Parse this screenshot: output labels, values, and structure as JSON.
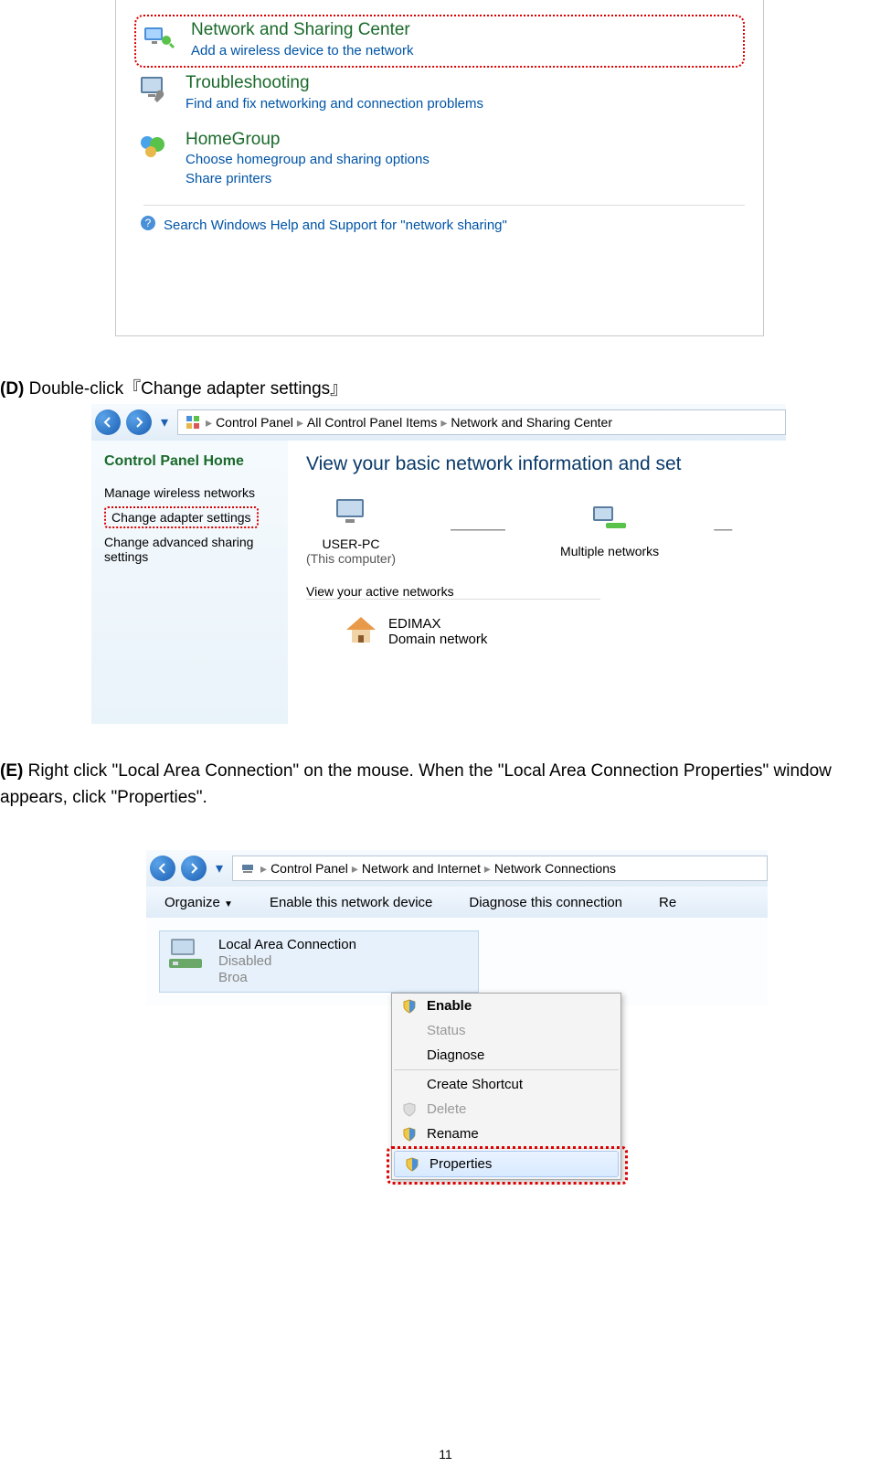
{
  "fig1": {
    "network_sharing": {
      "title": "Network and Sharing Center",
      "sub": "Add a wireless device to the network"
    },
    "troubleshooting": {
      "title": "Troubleshooting",
      "sub": "Find and fix networking and connection problems"
    },
    "homegroup": {
      "title": "HomeGroup",
      "sub1": "Choose homegroup and sharing options",
      "sub2": "Share printers"
    },
    "help_line": "Search Windows Help and Support for \"network sharing\""
  },
  "instruction_d": {
    "label": "(D)",
    "text": "Double-click『Change adapter settings』"
  },
  "fig2": {
    "breadcrumb": {
      "a": "Control Panel",
      "b": "All Control Panel Items",
      "c": "Network and Sharing Center"
    },
    "sidebar": {
      "home": "Control Panel Home",
      "items": [
        "Manage wireless networks",
        "Change adapter settings",
        "Change advanced sharing settings"
      ]
    },
    "main": {
      "heading": "View your basic network information and set",
      "pc_name": "USER-PC",
      "pc_sub": "(This computer)",
      "networks_label": "Multiple networks",
      "active_label": "View your active networks",
      "edimax_name": "EDIMAX",
      "edimax_type": "Domain network"
    }
  },
  "instruction_e": {
    "label": "(E)",
    "text": "Right click \"Local Area Connection\" on the mouse. When the \"Local Area Connection Properties\" window appears, click \"Properties\"."
  },
  "fig3": {
    "breadcrumb": {
      "a": "Control Panel",
      "b": "Network and Internet",
      "c": "Network Connections"
    },
    "toolbar": {
      "organize": "Organize",
      "enable": "Enable this network device",
      "diagnose": "Diagnose this connection",
      "rename_short": "Re"
    },
    "lac": {
      "title": "Local Area Connection",
      "status": "Disabled",
      "adapter": "Broa"
    },
    "menu": {
      "enable": "Enable",
      "status": "Status",
      "diagnose": "Diagnose",
      "create_shortcut": "Create Shortcut",
      "delete": "Delete",
      "rename": "Rename",
      "properties": "Properties"
    }
  },
  "page_number": "11"
}
